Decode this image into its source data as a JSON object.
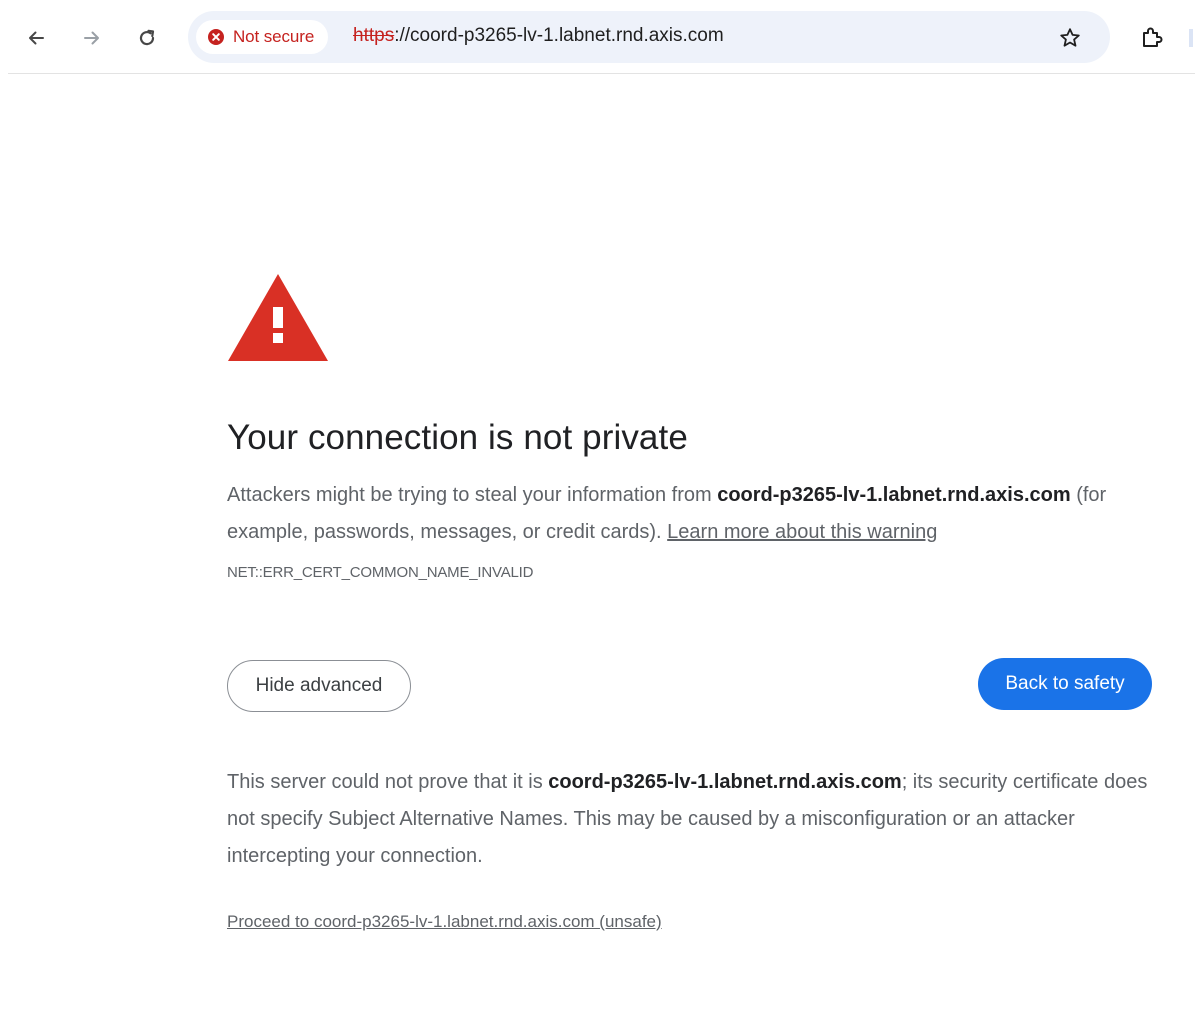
{
  "browser": {
    "security_chip_label": "Not secure",
    "security_chip_color": "#c5221f",
    "url_scheme": "https",
    "url_rest": "://coord-p3265-lv-1.labnet.rnd.axis.com",
    "icons": {
      "back": "back-arrow-icon",
      "forward": "forward-arrow-icon",
      "reload": "reload-icon",
      "not_secure": "not-secure-icon",
      "bookmark": "star-icon",
      "extensions": "puzzle-icon"
    }
  },
  "page": {
    "warning_icon": "warning-triangle-icon",
    "warning_color": "#d93025",
    "heading": "Your connection is not private",
    "explanation_prefix": "Attackers might be trying to steal your information from ",
    "host": "coord-p3265-lv-1.labnet.rnd.axis.com",
    "explanation_suffix": " (for example, passwords, messages, or credit cards). ",
    "learn_more_link": "Learn more about this warning",
    "error_code": "NET::ERR_CERT_COMMON_NAME_INVALID",
    "hide_advanced_label": "Hide advanced",
    "back_to_safety_label": "Back to safety",
    "primary_button_color": "#1a73e8",
    "details_prefix": "This server could not prove that it is ",
    "details_suffix": "; its security certificate does not specify Subject Alternative Names. This may be caused by a misconfiguration or an attacker intercepting your connection.",
    "proceed_link": "Proceed to coord-p3265-lv-1.labnet.rnd.axis.com (unsafe)"
  }
}
